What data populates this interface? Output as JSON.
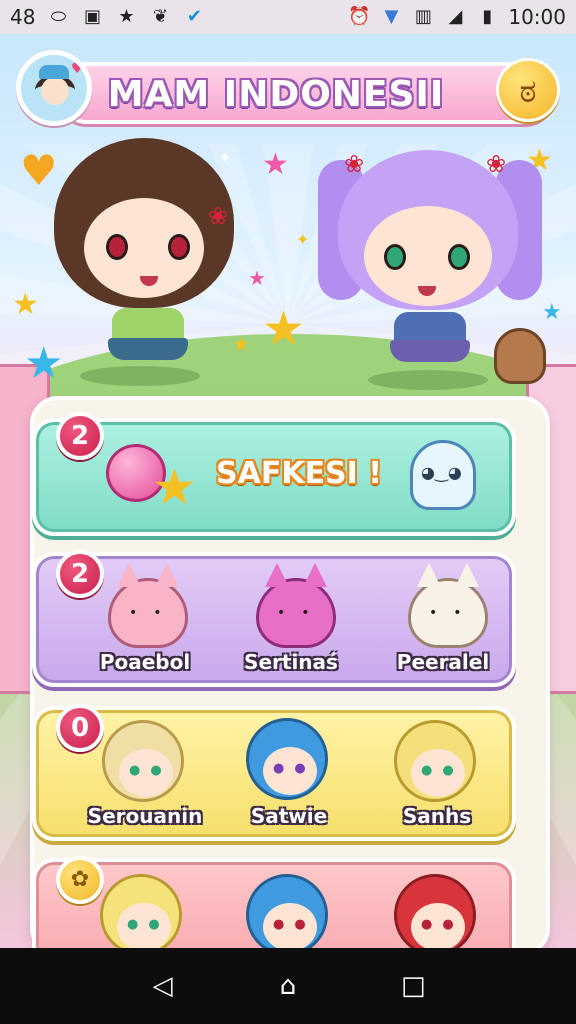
{
  "status_bar": {
    "left_text": "48",
    "icons_left": [
      "notification-icon",
      "picture-icon",
      "star-icon",
      "bird-icon",
      "check-shield-icon"
    ],
    "icons_right": [
      "alarm-icon",
      "wifi-icon",
      "no-sim-icon",
      "signal-icon",
      "battery-icon"
    ],
    "time": "10:00"
  },
  "header": {
    "title": "MAM INDONESII",
    "avatar_icon": "avatar-icon",
    "right_button_icon": "angry-face-icon"
  },
  "cards": [
    {
      "badge": "2",
      "headline": "SAFKESI !",
      "decor": [
        "candy-ball-icon",
        "star-icon",
        "ghost-mascot-icon"
      ]
    },
    {
      "badge": "2",
      "items": [
        {
          "label": "Poaebol",
          "color": "#f7b5c7"
        },
        {
          "label": "Sertinaś",
          "color": "#e86fc8"
        },
        {
          "label": "Peeralel",
          "color": "#f8f1e5"
        }
      ]
    },
    {
      "badge": "0",
      "items": [
        {
          "label": "Serouanin",
          "hair": "#f0dfa5"
        },
        {
          "label": "Satwie",
          "hair": "#3f9ae0"
        },
        {
          "label": "Sanhs",
          "hair": "#f4df7a"
        }
      ]
    },
    {
      "badge": "chick-icon",
      "items": [
        {
          "hair": "#f5e27a"
        },
        {
          "hair": "#3f9ae0"
        },
        {
          "hair": "#d7343c"
        }
      ]
    }
  ],
  "nav": {
    "back": "◁",
    "home": "⌂",
    "recents": "□"
  }
}
